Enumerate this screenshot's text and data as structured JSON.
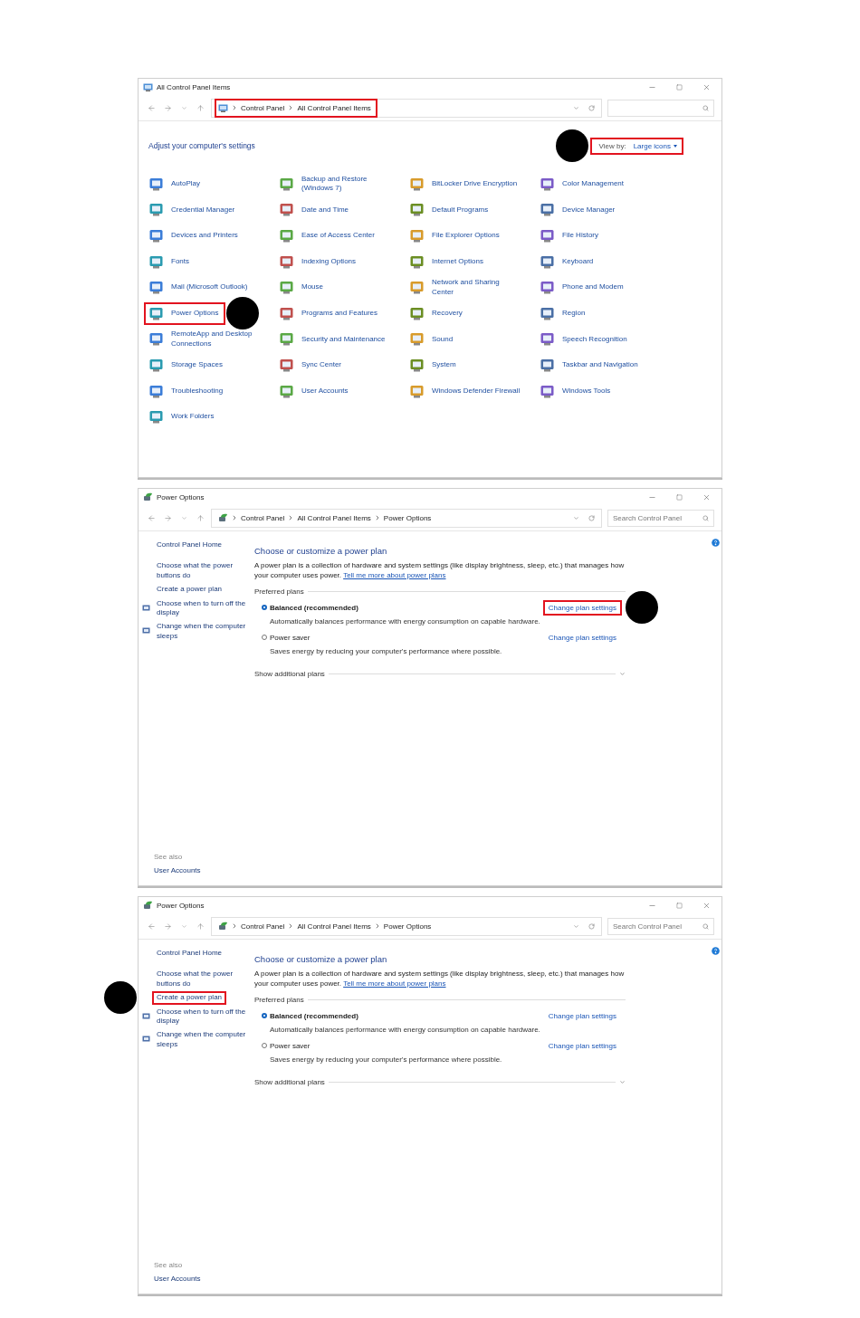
{
  "windows": [
    {
      "kind": "all_items",
      "title": "All Control Panel Items",
      "breadcrumb": {
        "segments": [
          "Control Panel",
          "All Control Panel Items"
        ],
        "highlighted": true
      },
      "heading": "Adjust your computer's settings",
      "view_by": {
        "label": "View by:",
        "value": "Large icons",
        "highlighted": true,
        "marker": true
      },
      "items": [
        {
          "label": "AutoPlay",
          "highlighted": false,
          "marker": false
        },
        {
          "label": "Backup and Restore (Windows 7)",
          "highlighted": false,
          "marker": false
        },
        {
          "label": "BitLocker Drive Encryption",
          "highlighted": false,
          "marker": false
        },
        {
          "label": "Color Management",
          "highlighted": false,
          "marker": false
        },
        {
          "label": "Credential Manager",
          "highlighted": false,
          "marker": false
        },
        {
          "label": "Date and Time",
          "highlighted": false,
          "marker": false
        },
        {
          "label": "Default Programs",
          "highlighted": false,
          "marker": false
        },
        {
          "label": "Device Manager",
          "highlighted": false,
          "marker": false
        },
        {
          "label": "Devices and Printers",
          "highlighted": false,
          "marker": false
        },
        {
          "label": "Ease of Access Center",
          "highlighted": false,
          "marker": false
        },
        {
          "label": "File Explorer Options",
          "highlighted": false,
          "marker": false
        },
        {
          "label": "File History",
          "highlighted": false,
          "marker": false
        },
        {
          "label": "Fonts",
          "highlighted": false,
          "marker": false
        },
        {
          "label": "Indexing Options",
          "highlighted": false,
          "marker": false
        },
        {
          "label": "Internet Options",
          "highlighted": false,
          "marker": false
        },
        {
          "label": "Keyboard",
          "highlighted": false,
          "marker": false
        },
        {
          "label": "Mail (Microsoft Outlook)",
          "highlighted": false,
          "marker": false
        },
        {
          "label": "Mouse",
          "highlighted": false,
          "marker": false
        },
        {
          "label": "Network and Sharing Center",
          "highlighted": false,
          "marker": false
        },
        {
          "label": "Phone and Modem",
          "highlighted": false,
          "marker": false
        },
        {
          "label": "Power Options",
          "highlighted": true,
          "marker": true
        },
        {
          "label": "Programs and Features",
          "highlighted": false,
          "marker": false
        },
        {
          "label": "Recovery",
          "highlighted": false,
          "marker": false
        },
        {
          "label": "Region",
          "highlighted": false,
          "marker": false
        },
        {
          "label": "RemoteApp and Desktop Connections",
          "highlighted": false,
          "marker": false
        },
        {
          "label": "Security and Maintenance",
          "highlighted": false,
          "marker": false
        },
        {
          "label": "Sound",
          "highlighted": false,
          "marker": false
        },
        {
          "label": "Speech Recognition",
          "highlighted": false,
          "marker": false
        },
        {
          "label": "Storage Spaces",
          "highlighted": false,
          "marker": false
        },
        {
          "label": "Sync Center",
          "highlighted": false,
          "marker": false
        },
        {
          "label": "System",
          "highlighted": false,
          "marker": false
        },
        {
          "label": "Taskbar and Navigation",
          "highlighted": false,
          "marker": false
        },
        {
          "label": "Troubleshooting",
          "highlighted": false,
          "marker": false
        },
        {
          "label": "User Accounts",
          "highlighted": false,
          "marker": false
        },
        {
          "label": "Windows Defender Firewall",
          "highlighted": false,
          "marker": false
        },
        {
          "label": "Windows Tools",
          "highlighted": false,
          "marker": false
        },
        {
          "label": "Work Folders",
          "highlighted": false,
          "marker": false
        }
      ]
    },
    {
      "kind": "power_options",
      "title": "Power Options",
      "breadcrumb": {
        "segments": [
          "Control Panel",
          "All Control Panel Items",
          "Power Options"
        ],
        "highlighted": false
      },
      "search": {
        "placeholder": "Search Control Panel"
      },
      "sidebar": {
        "links": [
          {
            "label": "Control Panel Home",
            "has_icon": false,
            "highlighted": false,
            "marker": false
          },
          {
            "label": "Choose what the power buttons do",
            "has_icon": false,
            "highlighted": false,
            "marker": false
          },
          {
            "label": "Create a power plan",
            "has_icon": false,
            "highlighted": false,
            "marker": false
          },
          {
            "label": "Choose when to turn off the display",
            "has_icon": true,
            "highlighted": false,
            "marker": false
          },
          {
            "label": "Change when the computer sleeps",
            "has_icon": true,
            "highlighted": false,
            "marker": false
          }
        ],
        "see_also": {
          "title": "See also",
          "links": [
            "User Accounts"
          ]
        }
      },
      "heading": "Choose or customize a power plan",
      "description": "A power plan is a collection of hardware and system settings (like display brightness, sleep, etc.) that manages how your computer uses power.",
      "description_link": "Tell me more about power plans",
      "section": "Preferred plans",
      "plans": [
        {
          "name": "Balanced (recommended)",
          "description": "Automatically balances performance with energy consumption on capable hardware.",
          "selected": true,
          "link": {
            "label": "Change plan settings",
            "highlighted": true,
            "marker": true
          }
        },
        {
          "name": "Power saver",
          "description": "Saves energy by reducing your computer's performance where possible.",
          "selected": false,
          "link": {
            "label": "Change plan settings",
            "highlighted": false,
            "marker": false
          }
        }
      ],
      "more": "Show additional plans"
    },
    {
      "kind": "power_options",
      "title": "Power Options",
      "breadcrumb": {
        "segments": [
          "Control Panel",
          "All Control Panel Items",
          "Power Options"
        ],
        "highlighted": false
      },
      "search": {
        "placeholder": "Search Control Panel"
      },
      "sidebar": {
        "links": [
          {
            "label": "Control Panel Home",
            "has_icon": false,
            "highlighted": false,
            "marker": false
          },
          {
            "label": "Choose what the power buttons do",
            "has_icon": false,
            "highlighted": false,
            "marker": false
          },
          {
            "label": "Create a power plan",
            "has_icon": false,
            "highlighted": true,
            "marker": true
          },
          {
            "label": "Choose when to turn off the display",
            "has_icon": true,
            "highlighted": false,
            "marker": false
          },
          {
            "label": "Change when the computer sleeps",
            "has_icon": true,
            "highlighted": false,
            "marker": false
          }
        ],
        "see_also": {
          "title": "See also",
          "links": [
            "User Accounts"
          ]
        }
      },
      "heading": "Choose or customize a power plan",
      "description": "A power plan is a collection of hardware and system settings (like display brightness, sleep, etc.) that manages how your computer uses power.",
      "description_link": "Tell me more about power plans",
      "section": "Preferred plans",
      "plans": [
        {
          "name": "Balanced (recommended)",
          "description": "Automatically balances performance with energy consumption on capable hardware.",
          "selected": true,
          "link": {
            "label": "Change plan settings",
            "highlighted": false,
            "marker": false
          }
        },
        {
          "name": "Power saver",
          "description": "Saves energy by reducing your computer's performance where possible.",
          "selected": false,
          "link": {
            "label": "Change plan settings",
            "highlighted": false,
            "marker": false
          }
        }
      ],
      "more": "Show additional plans"
    }
  ]
}
